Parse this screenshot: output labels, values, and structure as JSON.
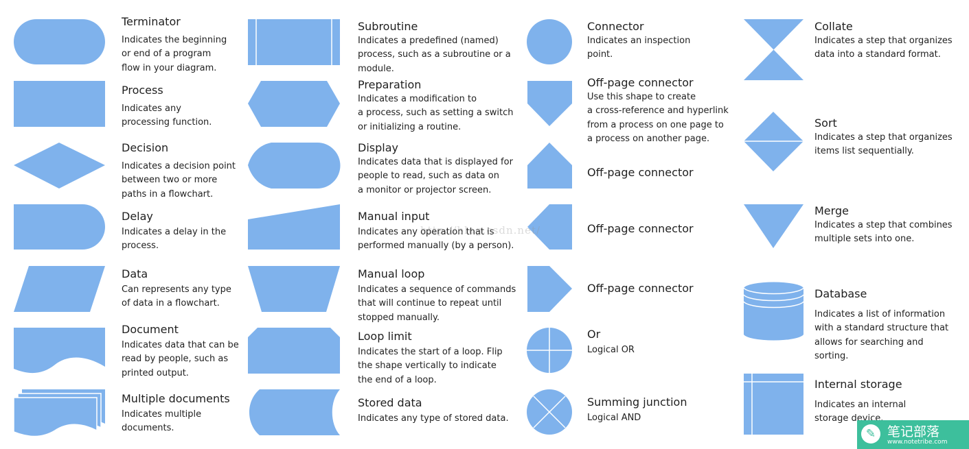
{
  "shape_color": "#7fb2ec",
  "items": {
    "terminator": {
      "title": "Terminator",
      "desc": "Indicates the beginning\nor end of a program\nflow in your diagram."
    },
    "process": {
      "title": "Process",
      "desc": "Indicates any\nprocessing function."
    },
    "decision": {
      "title": "Decision",
      "desc": "Indicates a decision point\nbetween two or more\npaths in a flowchart."
    },
    "delay": {
      "title": "Delay",
      "desc": "Indicates a delay in the\nprocess."
    },
    "data": {
      "title": "Data",
      "desc": "Can represents any type\nof data in a flowchart."
    },
    "document": {
      "title": "Document",
      "desc": "Indicates data that can be\nread by people, such as\nprinted output."
    },
    "multiple_documents": {
      "title": "Multiple documents",
      "desc": "Indicates multiple\ndocuments."
    },
    "subroutine": {
      "title": "Subroutine",
      "desc": "Indicates a predefined (named)\nprocess, such as a subroutine or a\nmodule."
    },
    "preparation": {
      "title": "Preparation",
      "desc": "Indicates a modification to\na process, such as setting a switch\nor initializing a routine."
    },
    "display": {
      "title": "Display",
      "desc": "Indicates data that is displayed for\npeople to read, such as data on\na monitor or projector screen."
    },
    "manual_input": {
      "title": "Manual input",
      "desc": "Indicates any operation that is\nperformed manually (by a person)."
    },
    "manual_loop": {
      "title": "Manual loop",
      "desc": "Indicates a sequence of commands\nthat will continue to repeat until\nstopped manually."
    },
    "loop_limit": {
      "title": "Loop limit",
      "desc": "Indicates the start of a loop. Flip\nthe shape vertically to indicate\nthe end of a loop."
    },
    "stored_data": {
      "title": "Stored data",
      "desc": "Indicates any type of stored data."
    },
    "connector": {
      "title": "Connector",
      "desc": "Indicates an inspection\npoint."
    },
    "offpage_down": {
      "title": "Off-page connector",
      "desc": "Use this shape to create\na cross-reference and hyperlink\nfrom a process on one page to\na process on another page."
    },
    "offpage_up": {
      "title": "Off-page connector"
    },
    "offpage_left": {
      "title": "Off-page connector"
    },
    "offpage_right": {
      "title": "Off-page connector"
    },
    "or": {
      "title": "Or",
      "desc": "Logical OR"
    },
    "summing_junction": {
      "title": "Summing junction",
      "desc": "Logical AND"
    },
    "collate": {
      "title": "Collate",
      "desc": "Indicates a step that organizes\ndata into a standard format."
    },
    "sort": {
      "title": "Sort",
      "desc": "Indicates a step that organizes\nitems list sequentially."
    },
    "merge": {
      "title": "Merge",
      "desc": "Indicates a step that combines\nmultiple sets into one."
    },
    "database": {
      "title": "Database",
      "desc": "Indicates a list of information\nwith a standard structure that\nallows for searching and\nsorting."
    },
    "internal_storage": {
      "title": "Internal storage",
      "desc": "Indicates an internal\nstorage device."
    }
  },
  "watermarks": {
    "csdn": "http://blog.csdn.net/",
    "logo_text": "笔记部落",
    "logo_url": "www.notetribe.com"
  }
}
